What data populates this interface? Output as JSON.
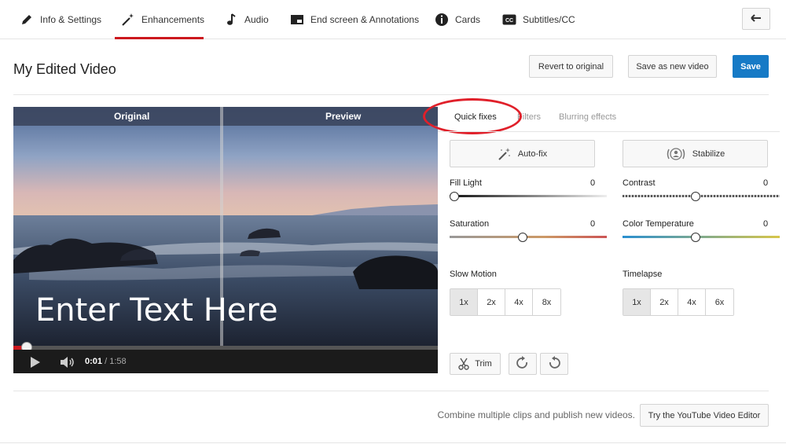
{
  "nav": {
    "tabs": [
      {
        "label": "Info & Settings",
        "icon": "pencil-icon"
      },
      {
        "label": "Enhancements",
        "icon": "magic-wand-icon"
      },
      {
        "label": "Audio",
        "icon": "music-note-icon"
      },
      {
        "label": "End screen & Annotations",
        "icon": "end-screen-icon"
      },
      {
        "label": "Cards",
        "icon": "info-circle-icon"
      },
      {
        "label": "Subtitles/CC",
        "icon": "cc-icon"
      }
    ],
    "active_tab": "Enhancements"
  },
  "header": {
    "title": "My Edited Video",
    "revert_label": "Revert to original",
    "save_new_label": "Save as new video",
    "save_label": "Save"
  },
  "video": {
    "original_label": "Original",
    "preview_label": "Preview",
    "overlay_text": "Enter Text Here",
    "current_time": "0:01",
    "separator": "/",
    "duration": "1:58",
    "progress": 0.01
  },
  "panel": {
    "tabs": [
      "Quick fixes",
      "Filters",
      "Blurring effects"
    ],
    "active_tab": "Quick fixes",
    "autofix_label": "Auto-fix",
    "stabilize_label": "Stabilize",
    "sliders": {
      "fill_light": {
        "label": "Fill Light",
        "value": "0"
      },
      "contrast": {
        "label": "Contrast",
        "value": "0"
      },
      "saturation": {
        "label": "Saturation",
        "value": "0"
      },
      "color_temperature": {
        "label": "Color Temperature",
        "value": "0"
      }
    },
    "slow_motion": {
      "label": "Slow Motion",
      "options": [
        "1x",
        "2x",
        "4x",
        "8x"
      ],
      "selected": "1x"
    },
    "timelapse": {
      "label": "Timelapse",
      "options": [
        "1x",
        "2x",
        "4x",
        "6x"
      ],
      "selected": "1x"
    },
    "trim_label": "Trim"
  },
  "footer": {
    "text": "Combine multiple clips and publish new videos.",
    "button_label": "Try the YouTube Video Editor"
  },
  "colors": {
    "accent_red": "#cc181e",
    "save_blue": "#167ac6",
    "annotation_red": "#e0202a"
  }
}
